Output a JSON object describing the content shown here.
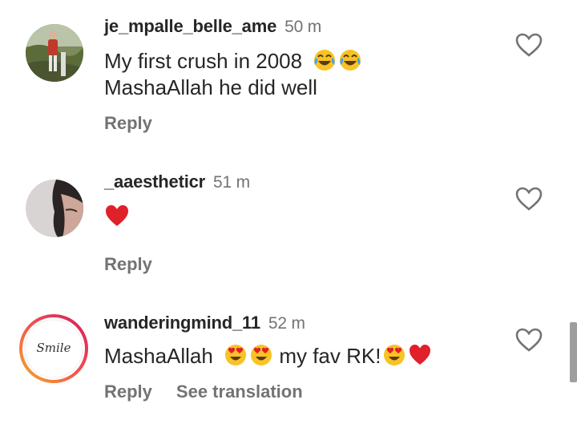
{
  "comments": [
    {
      "username": "je_mpalle_belle_ame",
      "time": "50 m",
      "line1": "My first crush in 2008",
      "line2": "MashaAllah he did well",
      "reply": "Reply"
    },
    {
      "username": "_aaestheticr",
      "time": "51 m",
      "reply": "Reply"
    },
    {
      "username": "wanderingmind_11",
      "time": "52 m",
      "text_a": "MashaAllah",
      "text_b": "my fav RK!",
      "reply": "Reply",
      "translation": "See translation",
      "avatar_text": "Smile"
    }
  ],
  "icons": {
    "like": "heart-outline-icon",
    "laugh": "face-with-tears-of-joy-emoji",
    "heart_eyes": "smiling-face-with-heart-eyes-emoji",
    "red_heart": "red-heart-emoji"
  },
  "colors": {
    "text": "#262626",
    "secondary": "#737373",
    "ring_start": "#f9a825",
    "ring_end": "#d81b60"
  }
}
